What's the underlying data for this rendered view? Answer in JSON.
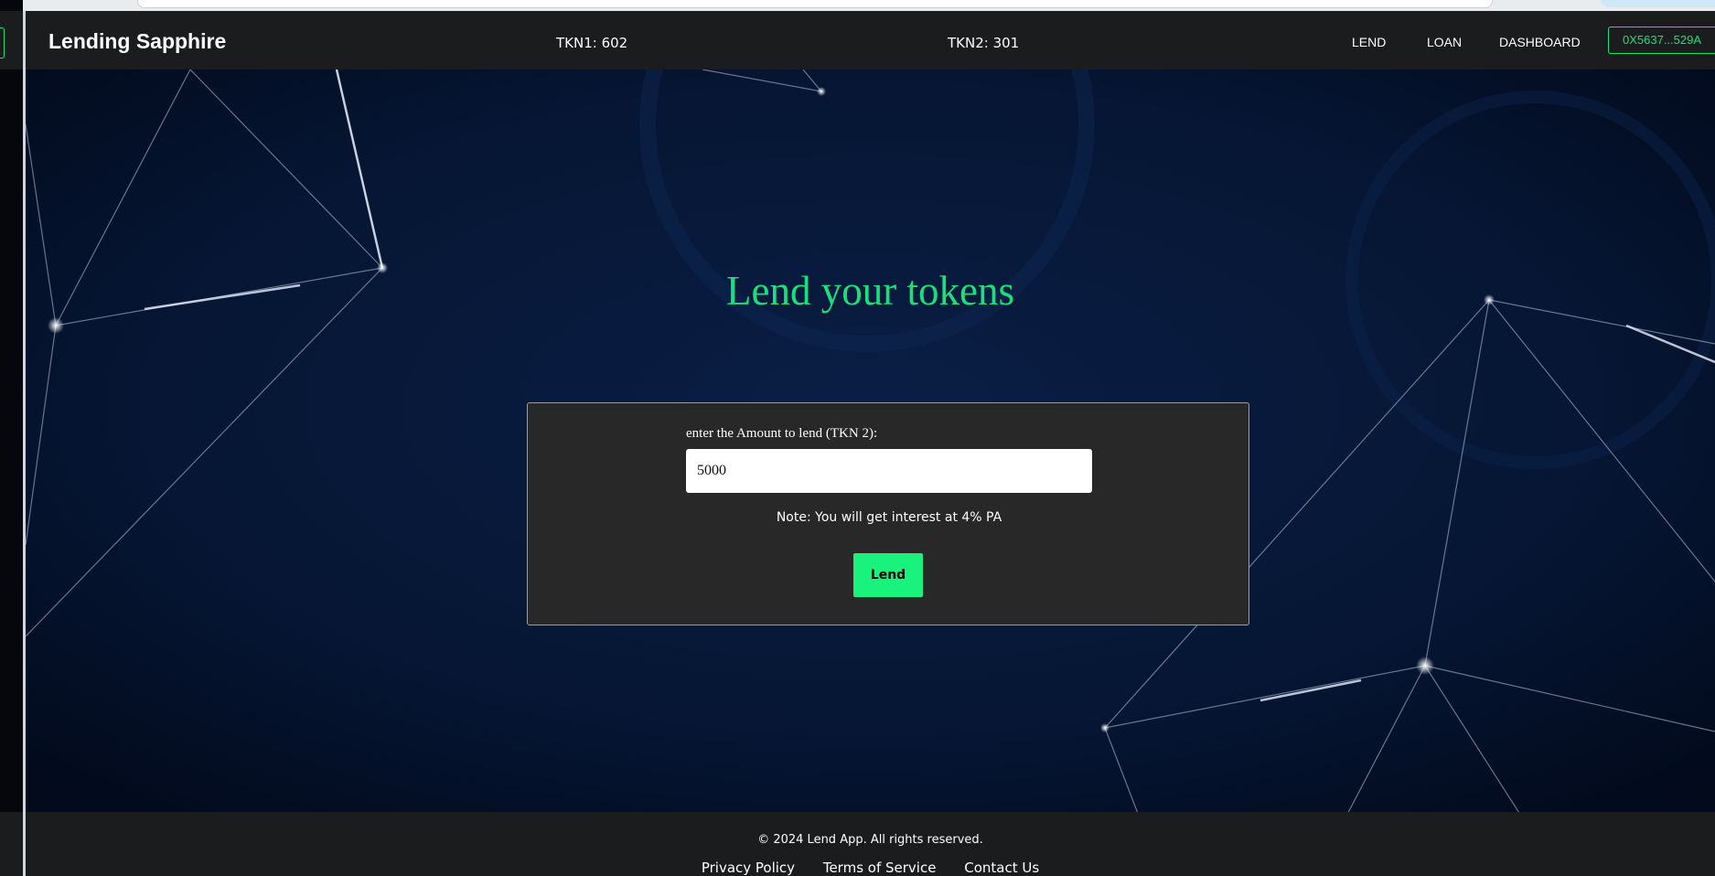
{
  "navbar": {
    "brand": "Lending Sapphire",
    "tkn1_balance": "TKN1: 602",
    "tkn2_balance": "TKN2: 301",
    "links": [
      "LEND",
      "LOAN",
      "DASHBOARD"
    ],
    "wallet": "0X5637...529A"
  },
  "main": {
    "headline": "Lend your tokens",
    "form": {
      "label": "enter the Amount to lend (TKN 2):",
      "amount_value": "5000",
      "note": "Note: You will get interest at 4% PA",
      "submit_label": "Lend"
    }
  },
  "footer": {
    "copyright": "© 2024 Lend App. All rights reserved.",
    "links": [
      "Privacy Policy",
      "Terms of Service",
      "Contact Us"
    ]
  },
  "colors": {
    "accent": "#19e07a",
    "navbar_bg": "#1b1c1e",
    "card_bg": "#282828",
    "page_bg": "#04102a"
  }
}
